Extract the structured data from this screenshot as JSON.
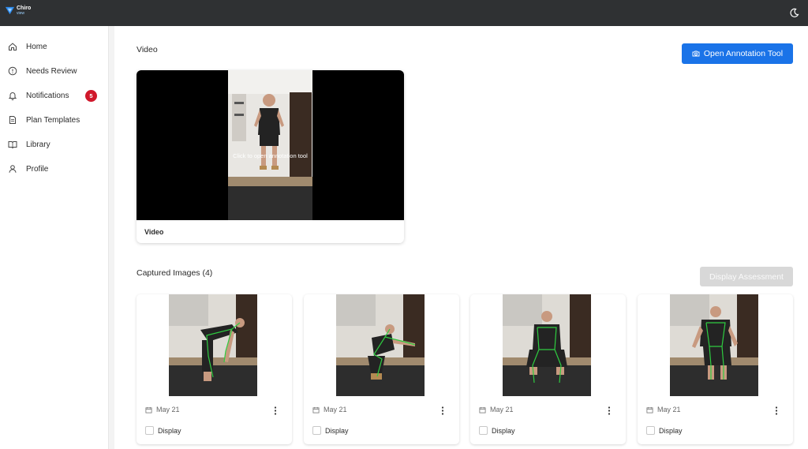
{
  "app": {
    "logo_text": "Chiro",
    "logo_subtext": "view"
  },
  "sidebar": {
    "items": [
      {
        "label": "Home",
        "icon": "home-icon"
      },
      {
        "label": "Needs Review",
        "icon": "alert-circle-icon"
      },
      {
        "label": "Notifications",
        "icon": "bell-icon",
        "badge": "5"
      },
      {
        "label": "Plan Templates",
        "icon": "document-icon"
      },
      {
        "label": "Library",
        "icon": "book-icon"
      },
      {
        "label": "Profile",
        "icon": "user-icon"
      }
    ]
  },
  "video_section": {
    "title": "Video",
    "open_tool_label": "Open Annotation Tool",
    "overlay_text": "Click to open annotation tool",
    "caption": "Video"
  },
  "images_section": {
    "title": "Captured Images (4)",
    "display_assessment_label": "Display Assessment",
    "images": [
      {
        "date": "May 21",
        "checkbox_label": "Display",
        "pose": "bend"
      },
      {
        "date": "May 21",
        "checkbox_label": "Display",
        "pose": "squat"
      },
      {
        "date": "May 21",
        "checkbox_label": "Display",
        "pose": "front-squat"
      },
      {
        "date": "May 21",
        "checkbox_label": "Display",
        "pose": "front-stand"
      }
    ]
  },
  "colors": {
    "topbar": "#2f3133",
    "primary": "#1a73e8",
    "badge": "#d0182b",
    "disabled": "#d8d8d8"
  }
}
